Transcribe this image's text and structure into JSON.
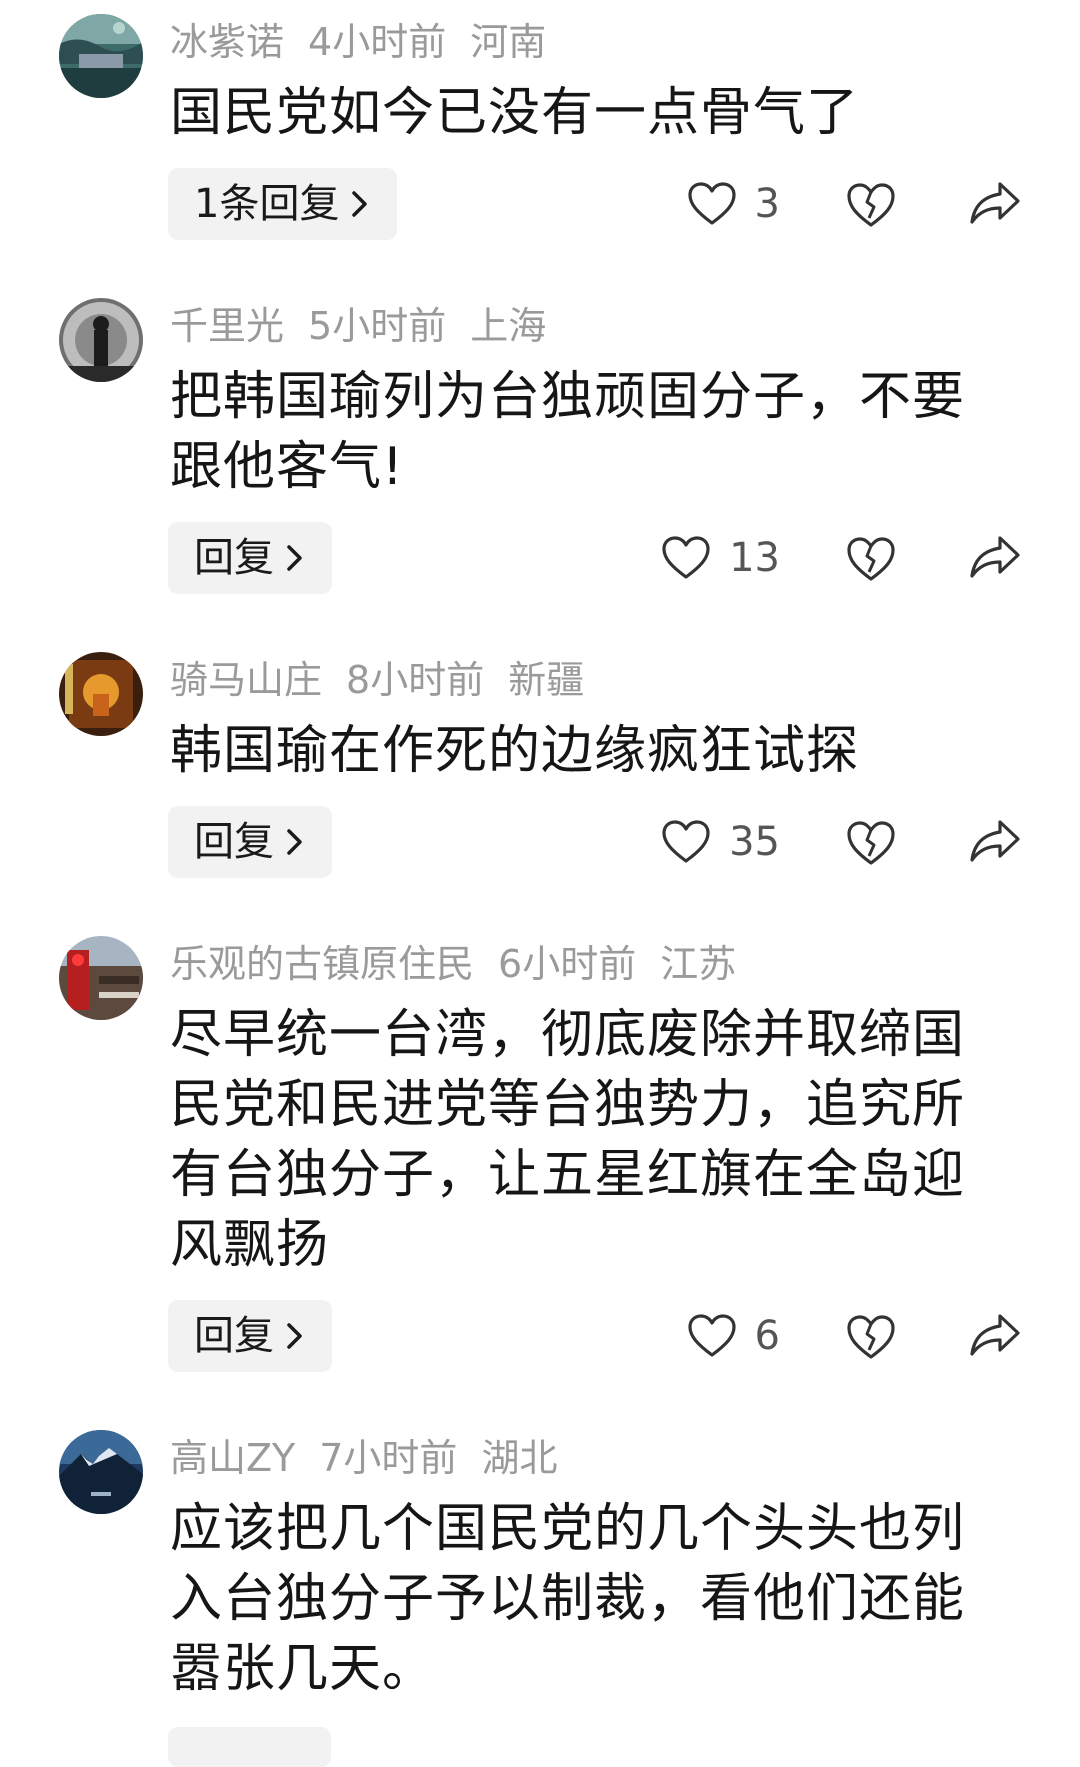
{
  "comments": [
    {
      "username": "冰紫诺",
      "time": "4小时前",
      "location": "河南",
      "text": "国民党如今已没有一点骨气了",
      "reply_label": "1条回复",
      "likes": "3"
    },
    {
      "username": "千里光",
      "time": "5小时前",
      "location": "上海",
      "text": "把韩国瑜列为台独顽固分子，不要跟他客气!",
      "reply_label": "回复",
      "likes": "13"
    },
    {
      "username": "骑马山庄",
      "time": "8小时前",
      "location": "新疆",
      "text": "韩国瑜在作死的边缘疯狂试探",
      "reply_label": "回复",
      "likes": "35"
    },
    {
      "username": "乐观的古镇原住民",
      "time": "6小时前",
      "location": "江苏",
      "text": "尽早统一台湾，彻底废除并取缔国民党和民进党等台独势力，追究所有台独分子，让五星红旗在全岛迎风飘扬",
      "reply_label": "回复",
      "likes": "6"
    },
    {
      "username": "高山ZY",
      "time": "7小时前",
      "location": "湖北",
      "text": "应该把几个国民党的几个头头也列入台独分子予以制裁，看他们还能嚣张几天。"
    }
  ],
  "icons": {
    "like": "heart-outline-icon",
    "dislike": "broken-heart-icon",
    "share": "share-arrow-icon",
    "reply_chevron": "chevron-right-icon"
  },
  "colors": {
    "meta_text": "#9a9a9a",
    "reply_bg": "#f2f2f2",
    "icon": "#333333"
  }
}
